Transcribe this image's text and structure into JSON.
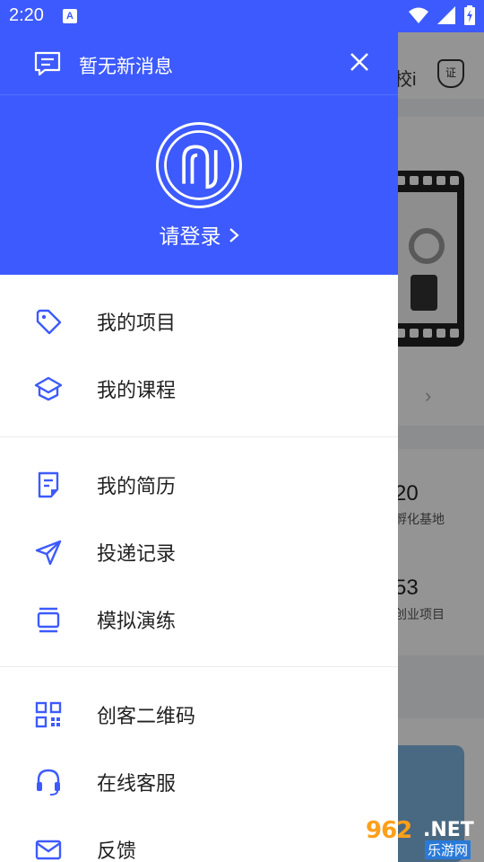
{
  "status_bar": {
    "time": "2:20",
    "notification_icon": "A"
  },
  "drawer": {
    "message_text": "暂无新消息",
    "login_text": "请登录",
    "groups": [
      [
        {
          "icon": "tag-icon",
          "label": "我的项目"
        },
        {
          "icon": "graduation-cap-icon",
          "label": "我的课程"
        }
      ],
      [
        {
          "icon": "resume-icon",
          "label": "我的简历"
        },
        {
          "icon": "send-icon",
          "label": "投递记录"
        },
        {
          "icon": "practice-icon",
          "label": "模拟演练"
        }
      ],
      [
        {
          "icon": "qr-code-icon",
          "label": "创客二维码"
        },
        {
          "icon": "headset-icon",
          "label": "在线客服"
        },
        {
          "icon": "mail-icon",
          "label": "反馈"
        }
      ]
    ]
  },
  "background": {
    "header_text": "校i",
    "cert_text": "证",
    "stat1_value": "20",
    "stat1_label": "孵化基地",
    "stat2_value": "53",
    "stat2_label": "创业项目"
  },
  "watermark": {
    "number": "962",
    "domain": ".NET",
    "site": "乐游网"
  },
  "colors": {
    "primary": "#3d5afe",
    "text": "#222222",
    "icon": "#3d5afe"
  }
}
